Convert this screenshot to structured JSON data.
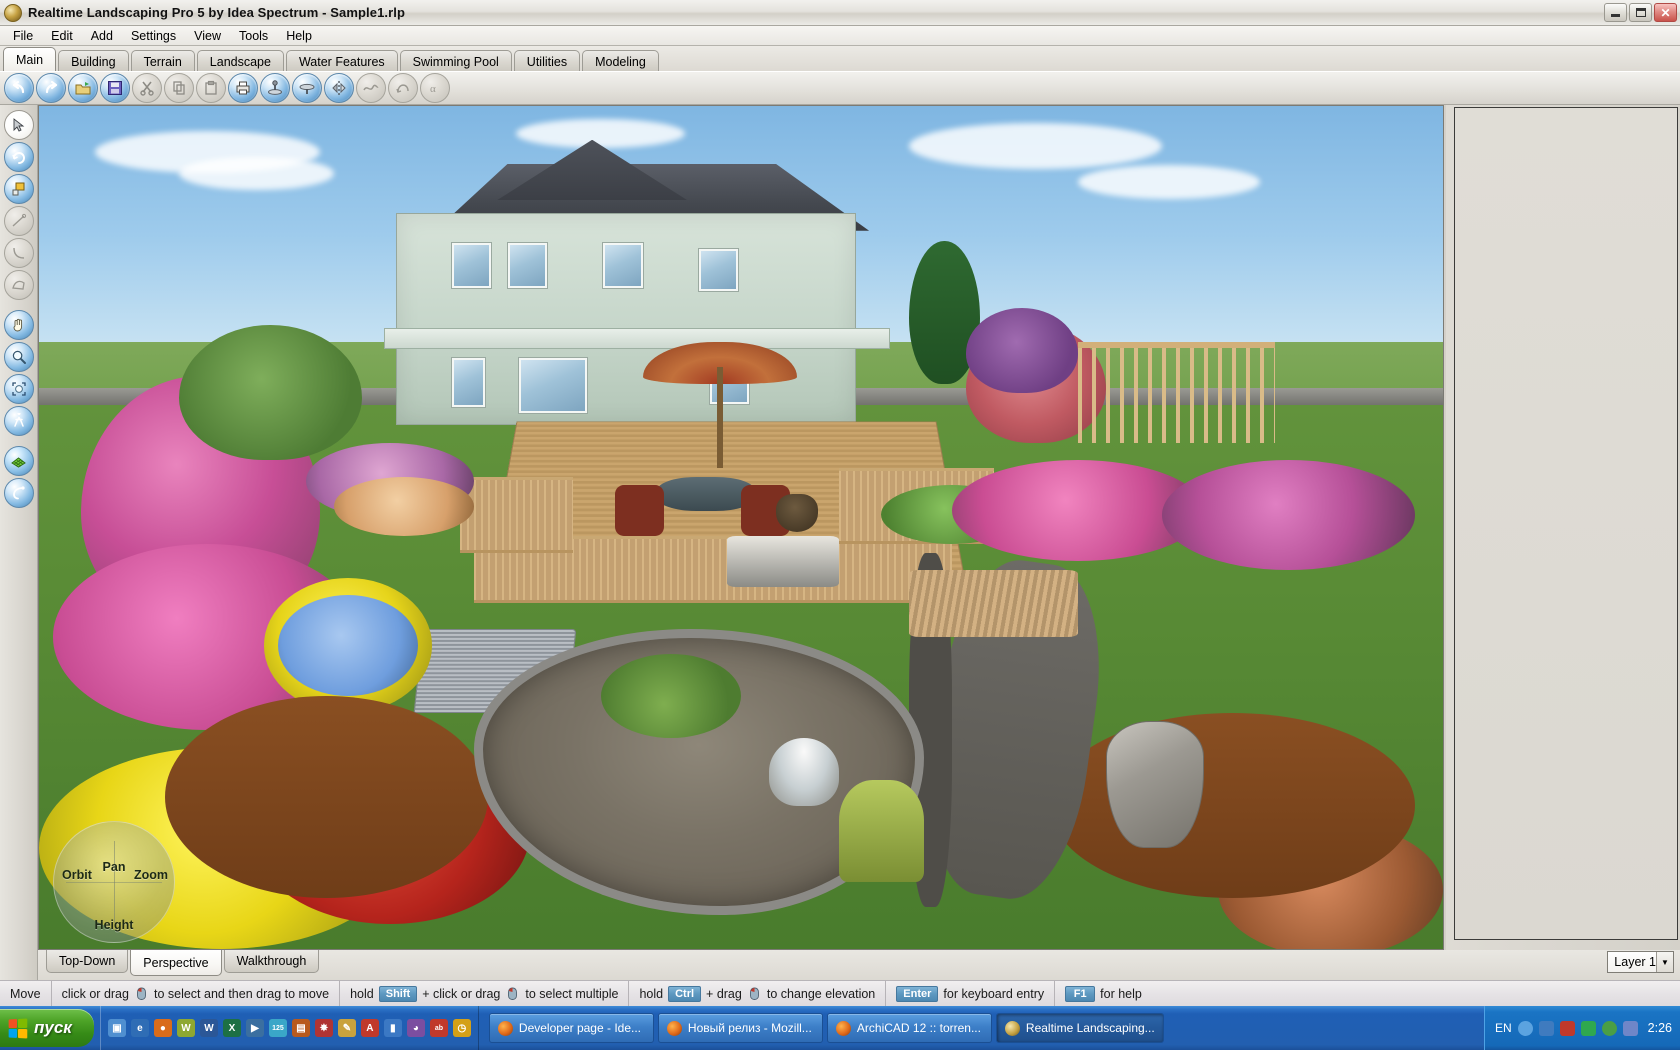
{
  "window": {
    "title": "Realtime Landscaping Pro 5 by Idea Spectrum - Sample1.rlp",
    "app_icon": "app-globe-icon",
    "controls": {
      "minimize": "Minimize",
      "maximize": "Maximize",
      "close": "Close"
    }
  },
  "menubar": {
    "items": [
      {
        "label": "File"
      },
      {
        "label": "Edit"
      },
      {
        "label": "Add"
      },
      {
        "label": "Settings"
      },
      {
        "label": "View"
      },
      {
        "label": "Tools"
      },
      {
        "label": "Help"
      }
    ]
  },
  "tabs": {
    "active": "Main",
    "items": [
      {
        "label": "Main"
      },
      {
        "label": "Building"
      },
      {
        "label": "Terrain"
      },
      {
        "label": "Landscape"
      },
      {
        "label": "Water Features"
      },
      {
        "label": "Swimming Pool"
      },
      {
        "label": "Utilities"
      },
      {
        "label": "Modeling"
      }
    ]
  },
  "toolbar": {
    "buttons": [
      {
        "name": "undo-icon",
        "enabled": true
      },
      {
        "name": "redo-icon",
        "enabled": true
      },
      {
        "name": "open-folder-icon",
        "enabled": true
      },
      {
        "name": "save-disk-icon",
        "enabled": true
      },
      {
        "name": "cut-scissors-icon",
        "enabled": false
      },
      {
        "name": "copy-icon",
        "enabled": false
      },
      {
        "name": "paste-icon",
        "enabled": false
      },
      {
        "name": "print-icon",
        "enabled": true
      },
      {
        "name": "align-ground-icon",
        "enabled": true
      },
      {
        "name": "terrain-flatten-icon",
        "enabled": true
      },
      {
        "name": "mirror-icon",
        "enabled": true
      },
      {
        "name": "smooth-curve-icon",
        "enabled": false
      },
      {
        "name": "rotate-curve-icon",
        "enabled": false
      },
      {
        "name": "scale-icon",
        "enabled": false
      }
    ]
  },
  "left_toolbar": {
    "buttons": [
      {
        "name": "select-arrow-tool",
        "state": "active"
      },
      {
        "name": "rotate-tool",
        "state": "enabled"
      },
      {
        "name": "properties-tool",
        "state": "enabled"
      },
      {
        "name": "line-draw-tool",
        "state": "disabled"
      },
      {
        "name": "arc-draw-tool",
        "state": "disabled"
      },
      {
        "name": "polygon-draw-tool",
        "state": "disabled"
      },
      {
        "name": "pan-hand-tool",
        "state": "enabled"
      },
      {
        "name": "zoom-magnifier-tool",
        "state": "enabled"
      },
      {
        "name": "zoom-extents-tool",
        "state": "enabled"
      },
      {
        "name": "walkthrough-tool",
        "state": "enabled"
      },
      {
        "name": "grid-terrain-tool",
        "state": "enabled"
      },
      {
        "name": "measure-tool",
        "state": "enabled"
      }
    ]
  },
  "viewport": {
    "name": "3d-landscape-render",
    "nav_widget": {
      "orbit": "Orbit",
      "zoom": "Zoom",
      "pan": "Pan",
      "height": "Height"
    }
  },
  "view_tabs": {
    "active": "Perspective",
    "items": [
      {
        "label": "Top-Down"
      },
      {
        "label": "Perspective"
      },
      {
        "label": "Walkthrough"
      }
    ]
  },
  "layer_select": {
    "value": "Layer 1",
    "arrow": "▼"
  },
  "statusbar": {
    "mode": "Move",
    "hints": [
      {
        "pre": "click or drag",
        "mouse": true,
        "post": "to select and then drag to move"
      },
      {
        "pre": "hold",
        "key": "Shift",
        "mid": "+ click or drag",
        "mouse": true,
        "post": "to select multiple"
      },
      {
        "pre": "hold",
        "key": "Ctrl",
        "mid": "+ drag",
        "mouse": true,
        "post": "to change elevation"
      },
      {
        "key": "Enter",
        "post": "for keyboard entry"
      },
      {
        "key": "F1",
        "post": "for help"
      }
    ]
  },
  "taskbar": {
    "start_label": "пуск",
    "quicklaunch": [
      {
        "name": "show-desktop-icon",
        "color": "#4f8fd0",
        "glyph": "▣"
      },
      {
        "name": "internet-explorer-icon",
        "color": "#2f6db5",
        "glyph": "e"
      },
      {
        "name": "firefox-icon",
        "color": "#d96c1a",
        "glyph": "●"
      },
      {
        "name": "winamp-icon",
        "color": "#8ea832",
        "glyph": "W"
      },
      {
        "name": "word-icon",
        "color": "#2b5797",
        "glyph": "W"
      },
      {
        "name": "excel-icon",
        "color": "#1d7044",
        "glyph": "X"
      },
      {
        "name": "media-player-icon",
        "color": "#3b6fa0",
        "glyph": "▶"
      },
      {
        "name": "downloader-icon",
        "color": "#3aa6c8",
        "glyph": "125"
      },
      {
        "name": "nero-icon",
        "color": "#b85a1e",
        "glyph": "▤"
      },
      {
        "name": "utility-icon",
        "color": "#b03434",
        "glyph": "✸"
      },
      {
        "name": "notes-icon",
        "color": "#c9a23d",
        "glyph": "✎"
      },
      {
        "name": "acrobat-icon",
        "color": "#c0392b",
        "glyph": "A"
      },
      {
        "name": "battery-icon",
        "color": "#3b78c4",
        "glyph": "▮"
      },
      {
        "name": "archive-icon",
        "color": "#7b4ea0",
        "glyph": "◕"
      },
      {
        "name": "abbyy-icon",
        "color": "#c0392b",
        "glyph": "ab"
      },
      {
        "name": "clock-icon",
        "color": "#d4a017",
        "glyph": "◷"
      }
    ],
    "items": [
      {
        "label": "Developer page - Ide...",
        "icon": "firefox-icon",
        "active": false
      },
      {
        "label": "Новый релиз - Mozill...",
        "icon": "firefox-icon",
        "active": false
      },
      {
        "label": "ArchiCAD 12 :: torren...",
        "icon": "firefox-icon",
        "active": false
      },
      {
        "label": "Realtime Landscaping...",
        "icon": "app-globe-icon",
        "active": true
      }
    ],
    "tray": {
      "language": "EN",
      "icons": [
        {
          "name": "tray-expand-icon",
          "color": "#5ba3e0",
          "glyph": "‹"
        },
        {
          "name": "network-icon",
          "color": "#3f7bbf",
          "glyph": "⇄"
        },
        {
          "name": "antivirus-icon",
          "color": "#c0392b",
          "glyph": "V"
        },
        {
          "name": "power-icon",
          "color": "#2fa84f",
          "glyph": "⚡"
        },
        {
          "name": "update-icon",
          "color": "#4a9e46",
          "glyph": "⬆"
        },
        {
          "name": "mail-icon",
          "color": "#6f86c8",
          "glyph": "✉"
        }
      ],
      "clock": "2:26"
    }
  },
  "colors": {
    "accent": "#4d88b2",
    "taskbar_blue": "#225fb0",
    "start_green": "#368b17",
    "window_chrome": "#d4d0c8"
  }
}
